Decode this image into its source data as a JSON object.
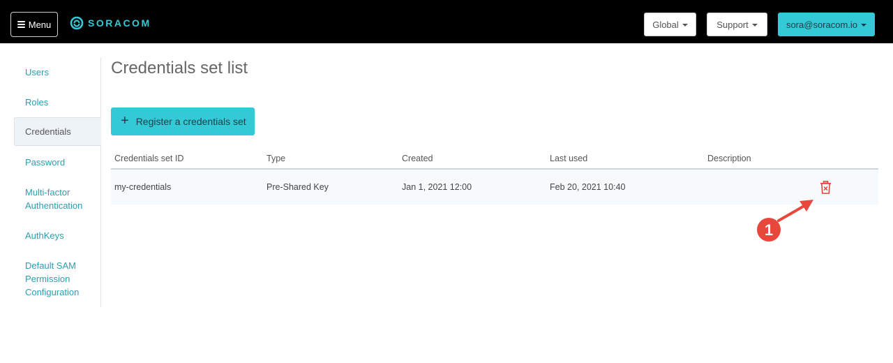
{
  "header": {
    "menu_label": "Menu",
    "logo_text": "SORACOM",
    "global_label": "Global",
    "support_label": "Support",
    "user_label": "sora@soracom.io"
  },
  "sidebar": {
    "items": [
      {
        "label": "Users"
      },
      {
        "label": "Roles"
      },
      {
        "label": "Credentials"
      },
      {
        "label": "Password"
      },
      {
        "label": "Multi-factor Authentication"
      },
      {
        "label": "AuthKeys"
      },
      {
        "label": "Default SAM Permission Configuration"
      }
    ],
    "active": "Credentials"
  },
  "main": {
    "title": "Credentials set list",
    "register_label": "Register a credentials set",
    "table": {
      "columns": [
        "Credentials set ID",
        "Type",
        "Created",
        "Last used",
        "Description"
      ],
      "rows": [
        {
          "id": "my-credentials",
          "type": "Pre-Shared Key",
          "created": "Jan 1, 2021 12:00",
          "last_used": "Feb 20, 2021 10:40",
          "description": ""
        }
      ]
    }
  },
  "annotation": {
    "number": "1"
  },
  "colors": {
    "accent": "#34c9d6",
    "link": "#2a9fb0",
    "delete": "#e0443a",
    "annotation": "#e8483b"
  },
  "icons": [
    "hamburger-icon",
    "soracom-logo-icon",
    "caret-down-icon",
    "plus-icon",
    "trash-icon",
    "arrow-icon"
  ]
}
